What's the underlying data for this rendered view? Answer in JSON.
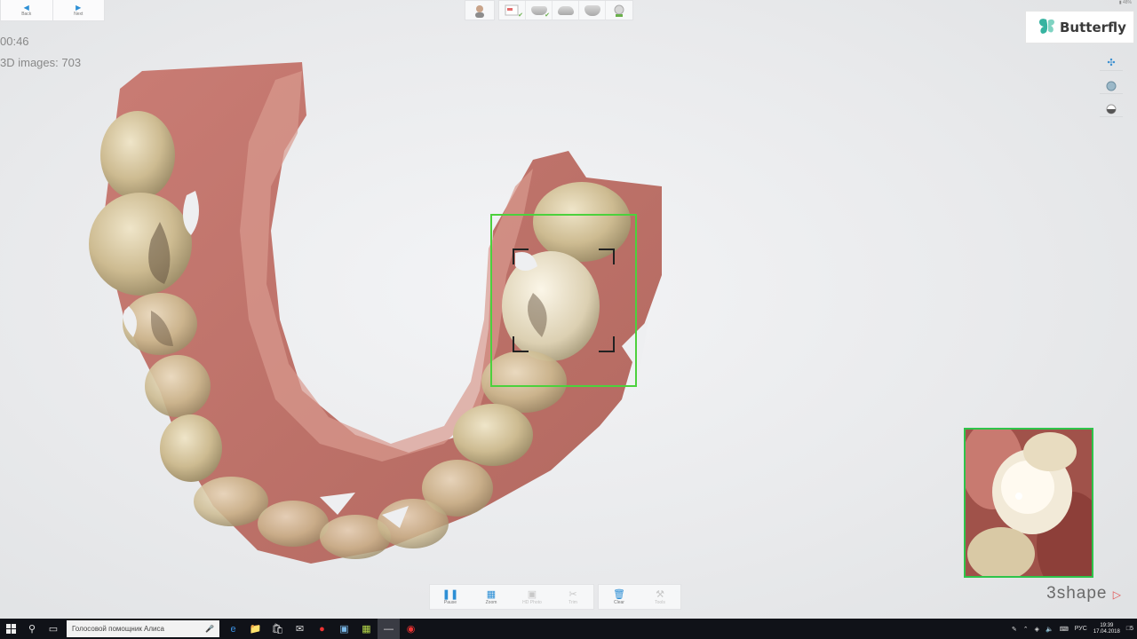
{
  "nav": {
    "back_label": "Back",
    "next_label": "Next"
  },
  "scan": {
    "timer": "00:46",
    "images_label": "3D images: 703"
  },
  "logo": {
    "name": "Butterfly"
  },
  "toolbar": {
    "pause": "Pause",
    "zoom": "Zoom",
    "hd_photo": "HD Photo",
    "trim": "Trim",
    "clear": "Clear",
    "tools": "Tools"
  },
  "brand": {
    "name": "3shape"
  },
  "taskbar": {
    "search_text": "Голосовой помощник Алиса",
    "lang": "РУС",
    "time": "19:39",
    "date": "17.04.2018",
    "notif_count": "5"
  },
  "tray_top": {
    "battery": "48%"
  },
  "colors": {
    "accent": "#2d8fd5",
    "scan_frame": "#4cd13d",
    "preview_frame": "#2ec44a",
    "taskbar": "#101218"
  },
  "icons": {
    "back": "arrow-left-icon",
    "next": "arrow-right-icon",
    "pause": "pause-icon",
    "zoom": "zoom-icon",
    "hd_photo": "camera-icon",
    "trim": "scissors-icon",
    "clear": "trash-icon",
    "tools": "wrench-icon"
  }
}
